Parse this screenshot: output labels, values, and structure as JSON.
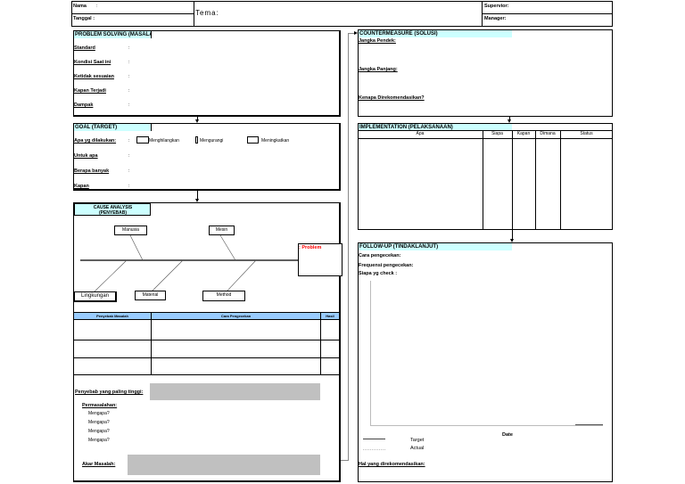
{
  "header": {
    "nama": "Nama",
    "nama_colon": ":",
    "tanggal": "Tanggal :",
    "tema": "Tema:",
    "supervisor": "Supervior:",
    "manager": "Manager:"
  },
  "problem": {
    "title": "PROBLEM SOLVING (MASALA",
    "colon": ":",
    "fields": [
      "Standard",
      "Kondisi Saat ini",
      "Ketidak sesuaian",
      "Kapan Terjadi",
      "Dampak"
    ]
  },
  "goal": {
    "title": "GOAL (TARGET)",
    "colon": ":",
    "fields": [
      "Apa yg dilakukan:",
      "Untuk apa",
      "Berapa banyak",
      "Kapan"
    ],
    "options": [
      "Menghilangkan",
      "Mengurangi",
      "Meningkatkan"
    ]
  },
  "cause": {
    "title1": "CAUSE ANALYSIS",
    "title2": "(PENYEBAB)",
    "bones": {
      "manusia": "Manusia",
      "mesin": "Mesin",
      "lingkungan": "Lingkungan",
      "material": "Material",
      "method": "Method"
    },
    "problem": ": Problem",
    "problem_color": "#ff0000",
    "table_headers": [
      "Penyebab Masalah",
      "Cara Pengecekan",
      "Hasil"
    ],
    "top_cause": "Penyebab yang paling tinggi:",
    "permasalahan": "Permasalahan:",
    "why": [
      "Mengapa?",
      "Mengapa?",
      "Mengapa?",
      "Mengapa?"
    ],
    "root": "Akar Masalah:"
  },
  "countermeasure": {
    "title": "COUNTERMEASURE (SOLUSI)",
    "short": "Jangka Pendek:",
    "long": "Jangka Panjang:",
    "why": "Kenapa Direkomendasikan?"
  },
  "implementation": {
    "title": "IMPLEMENTATION (PELAKSANAAN)",
    "headers": [
      "Apa",
      "Siapa",
      "Kapan",
      "Dimana",
      "Status"
    ]
  },
  "followup": {
    "title": "FOLLOW-UP (TINDAKLANJUT)",
    "cara": "Cara pengecekan:",
    "freq": "Frequensi pengecekan:",
    "siapa": "Siapa yg check :",
    "xlabel": "Date",
    "legend": [
      "Target",
      "Actual"
    ],
    "rekomendasi": "Hal yang direkomendasikan:"
  },
  "colors": {
    "section_header": "#ccffff",
    "table_header": "#99ccff",
    "highlight": "#c0c0c0"
  }
}
